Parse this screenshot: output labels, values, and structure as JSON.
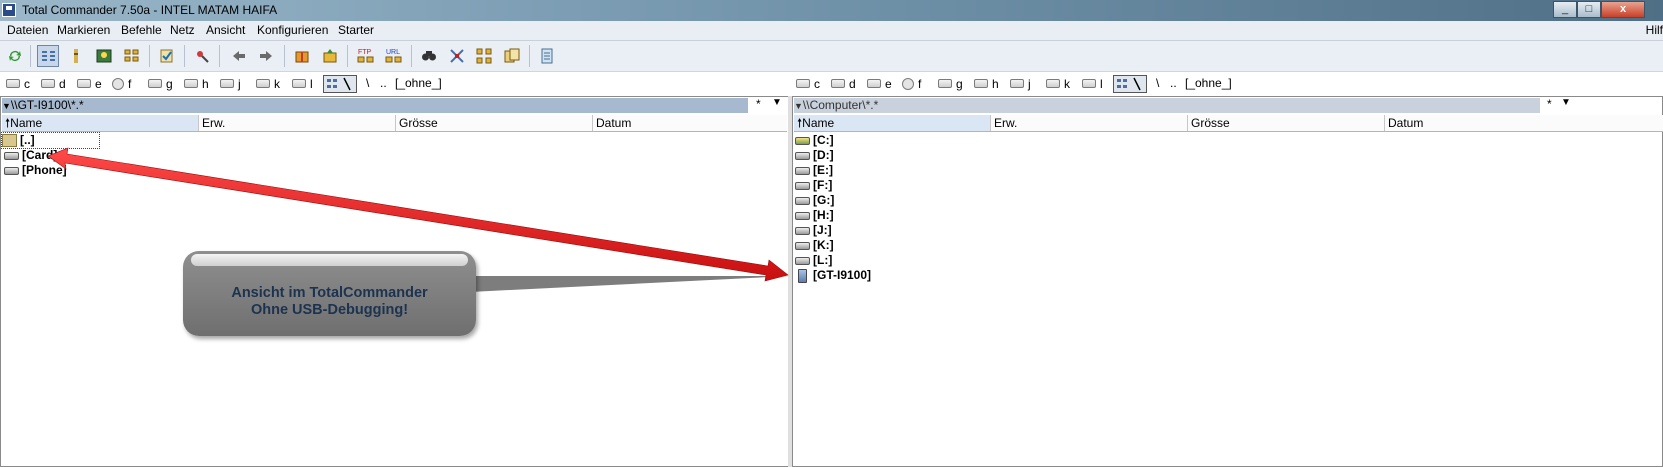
{
  "window": {
    "title": "Total Commander 7.50a - INTEL MATAM HAIFA",
    "buttons": [
      "minimize-icon",
      "maximize-icon",
      "close-icon"
    ]
  },
  "menu": {
    "items": [
      "Dateien",
      "Markieren",
      "Befehle",
      "Netz",
      "Ansicht",
      "Konfigurieren",
      "Starter"
    ],
    "help": "Hilf"
  },
  "toolbar": {
    "icons": [
      "refresh-icon",
      "brief-view-icon",
      "full-view-icon",
      "thumbnail-view-icon",
      "tree-view-icon",
      "invert-selection-icon",
      "unpack-icon",
      "back-icon",
      "forward-icon",
      "pack-icon",
      "unpack-files-icon",
      "ftp-connect-icon",
      "url-connect-icon",
      "search-icon",
      "multi-rename-icon",
      "sync-dirs-icon",
      "compare-icon",
      "notepad-icon"
    ],
    "ftp_label": "FTP",
    "url_label": "URL"
  },
  "left": {
    "drives": [
      "c",
      "d",
      "e",
      "f",
      "g",
      "h",
      "j",
      "k",
      "l"
    ],
    "root": "\\",
    "up": "..",
    "none": "[_ohne_]",
    "path": "\\\\GT-I9100\\*.*",
    "filter_star": "*",
    "columns": {
      "name": "Name",
      "ext": "Erw.",
      "size": "Grösse",
      "date": "Datum"
    },
    "items": [
      {
        "name": "[..]",
        "icon": "up-dir-icon"
      },
      {
        "name": "[Card]",
        "icon": "drive-icon"
      },
      {
        "name": "[Phone]",
        "icon": "drive-icon"
      }
    ]
  },
  "right": {
    "drives": [
      "c",
      "d",
      "e",
      "f",
      "g",
      "h",
      "j",
      "k",
      "l"
    ],
    "root": "\\",
    "up": "..",
    "none": "[_ohne_]",
    "path": "\\\\Computer\\*.*",
    "filter_star": "*",
    "columns": {
      "name": "Name",
      "ext": "Erw.",
      "size": "Grösse",
      "date": "Datum"
    },
    "items": [
      {
        "name": "[C:]",
        "icon": "system-drive-icon"
      },
      {
        "name": "[D:]",
        "icon": "drive-icon"
      },
      {
        "name": "[E:]",
        "icon": "drive-icon"
      },
      {
        "name": "[F:]",
        "icon": "cd-drive-icon"
      },
      {
        "name": "[G:]",
        "icon": "drive-icon"
      },
      {
        "name": "[H:]",
        "icon": "drive-icon"
      },
      {
        "name": "[J:]",
        "icon": "drive-icon"
      },
      {
        "name": "[K:]",
        "icon": "drive-icon"
      },
      {
        "name": "[L:]",
        "icon": "drive-icon"
      },
      {
        "name": "[GT-I9100]",
        "icon": "phone-icon"
      }
    ]
  },
  "callout": {
    "line1": "Ansicht im TotalCommander",
    "line2": "Ohne USB-Debugging!"
  },
  "colors": {
    "arrow": "#e51a1a",
    "path_active": "#a7b9cf",
    "callout": "#7f7f7f",
    "callout_text": "#1c3350"
  }
}
